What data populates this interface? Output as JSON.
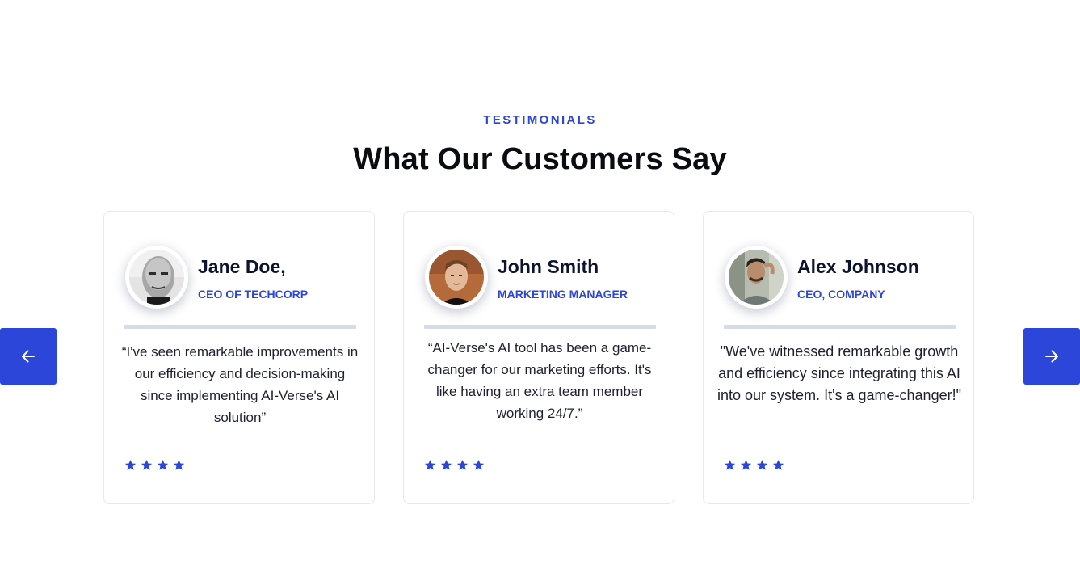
{
  "section": {
    "eyebrow": "TESTIMONIALS",
    "heading": "What Our Customers Say"
  },
  "colors": {
    "accent": "#2b46d8",
    "heading": "#0b0b12",
    "name": "#0d1230",
    "quote": "#1e2030",
    "divider": "#d6dbe8",
    "card_border": "#e6e8ee"
  },
  "navigation": {
    "prev_icon": "arrow-left-icon",
    "next_icon": "arrow-right-icon"
  },
  "testimonials": [
    {
      "name": "Jane Doe,",
      "role": "CEO OF TECHCORP",
      "quote": "“I've seen remarkable improvements in our efficiency and decision-making since implementing AI-Verse's AI solution”",
      "rating": 4,
      "avatar": "avatar-photo-man-grayscale"
    },
    {
      "name": "John Smith",
      "role": "MARKETING MANAGER",
      "quote": "“AI-Verse's AI tool has been a game-changer for our marketing efforts. It's like having an extra team member working 24/7.”",
      "rating": 4,
      "avatar": "avatar-photo-young-man"
    },
    {
      "name": "Alex Johnson",
      "role": "CEO, COMPANY",
      "quote": "\"We've witnessed remarkable growth and efficiency since integrating this AI into our system. It's a game-changer!\"",
      "rating": 4,
      "avatar": "avatar-photo-man-outdoors"
    }
  ]
}
